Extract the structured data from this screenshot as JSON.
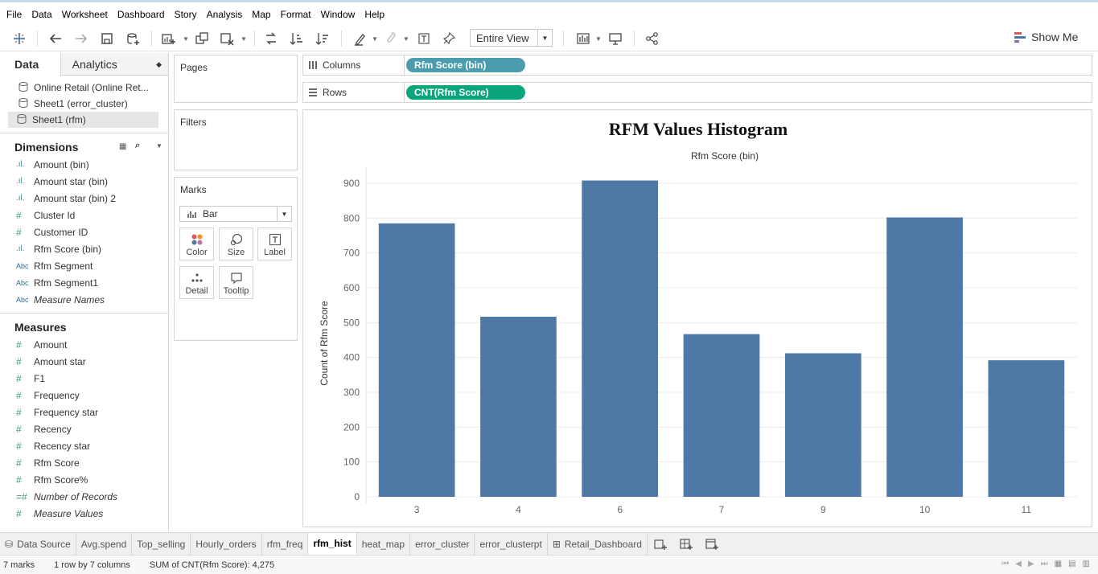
{
  "menu": [
    "File",
    "Data",
    "Worksheet",
    "Dashboard",
    "Story",
    "Analysis",
    "Map",
    "Format",
    "Window",
    "Help"
  ],
  "toolbar": {
    "fit": "Entire View",
    "show_me": "Show Me",
    "icons": [
      "tableau-logo-icon",
      "undo-icon",
      "redo-icon",
      "save-icon",
      "new-datasource-icon",
      "new-worksheet-icon",
      "duplicate-sheet-icon",
      "clear-sheet-icon",
      "swap-icon",
      "sort-ascending-icon",
      "sort-descending-icon",
      "highlight-icon",
      "group-icon",
      "label-icon",
      "pin-icon",
      "bar-chart-icon",
      "presentation-icon",
      "share-icon"
    ]
  },
  "data_pane": {
    "tabs": {
      "data": "Data",
      "analytics": "Analytics"
    },
    "datasources": [
      {
        "label": "Online Retail (Online Ret...",
        "selected": false
      },
      {
        "label": "Sheet1 (error_cluster)",
        "selected": false
      },
      {
        "label": "Sheet1 (rfm)",
        "selected": true
      }
    ],
    "dimensions_title": "Dimensions",
    "dimensions": [
      {
        "icon": "bin",
        "label": "Amount (bin)",
        "italic": false
      },
      {
        "icon": "bin",
        "label": "Amount star (bin)",
        "italic": false
      },
      {
        "icon": "bin",
        "label": "Amount star (bin) 2",
        "italic": false
      },
      {
        "icon": "hash",
        "label": "Cluster Id",
        "italic": false
      },
      {
        "icon": "hash",
        "label": "Customer ID",
        "italic": false
      },
      {
        "icon": "bin",
        "label": "Rfm Score (bin)",
        "italic": false
      },
      {
        "icon": "abc",
        "label": "Rfm Segment",
        "italic": false
      },
      {
        "icon": "abc",
        "label": "Rfm Segment1",
        "italic": false
      },
      {
        "icon": "abc",
        "label": "Measure Names",
        "italic": true
      }
    ],
    "measures_title": "Measures",
    "measures": [
      {
        "icon": "hash",
        "label": "Amount",
        "italic": false
      },
      {
        "icon": "hash",
        "label": "Amount star",
        "italic": false
      },
      {
        "icon": "hash",
        "label": "F1",
        "italic": false
      },
      {
        "icon": "hash",
        "label": "Frequency",
        "italic": false
      },
      {
        "icon": "hash",
        "label": "Frequency star",
        "italic": false
      },
      {
        "icon": "hash",
        "label": "Recency",
        "italic": false
      },
      {
        "icon": "hash",
        "label": "Recency star",
        "italic": false
      },
      {
        "icon": "hash",
        "label": "Rfm Score",
        "italic": false
      },
      {
        "icon": "hash",
        "label": "Rfm Score%",
        "italic": false
      },
      {
        "icon": "calc",
        "label": "Number of Records",
        "italic": true
      },
      {
        "icon": "hash",
        "label": "Measure Values",
        "italic": true
      }
    ]
  },
  "cards": {
    "pages": "Pages",
    "filters": "Filters",
    "marks": "Marks",
    "mark_type": "Bar",
    "mark_buttons": [
      "Color",
      "Size",
      "Label",
      "Detail",
      "Tooltip"
    ]
  },
  "shelves": {
    "columns_label": "Columns",
    "columns_pill": "Rfm Score (bin)",
    "rows_label": "Rows",
    "rows_pill": "CNT(Rfm Score)"
  },
  "colors": {
    "bar": "#4e79a7",
    "columns_pill": "#4b9dae",
    "rows_pill": "#0aa67b"
  },
  "chart_data": {
    "type": "bar",
    "title": "RFM Values Histogram",
    "xlabel": "Rfm Score (bin)",
    "ylabel": "Count of Rfm Score",
    "categories": [
      "3",
      "4",
      "6",
      "7",
      "9",
      "10",
      "11"
    ],
    "values": [
      785,
      517,
      908,
      467,
      412,
      802,
      392
    ],
    "ylim": [
      0,
      900
    ],
    "yticks": [
      0,
      100,
      200,
      300,
      400,
      500,
      600,
      700,
      800,
      900
    ],
    "grid": true
  },
  "sheet_tabs": {
    "data_source": "Data Source",
    "sheets": [
      {
        "label": "Avg.spend",
        "active": false,
        "icon": ""
      },
      {
        "label": "Top_selling",
        "active": false,
        "icon": ""
      },
      {
        "label": "Hourly_orders",
        "active": false,
        "icon": ""
      },
      {
        "label": "rfm_freq",
        "active": false,
        "icon": ""
      },
      {
        "label": "rfm_hist",
        "active": true,
        "icon": ""
      },
      {
        "label": "heat_map",
        "active": false,
        "icon": ""
      },
      {
        "label": "error_cluster",
        "active": false,
        "icon": ""
      },
      {
        "label": "error_clusterpt",
        "active": false,
        "icon": ""
      },
      {
        "label": "Retail_Dashboard",
        "active": false,
        "icon": "dashboard"
      }
    ]
  },
  "status": {
    "marks": "7 marks",
    "layout": "1 row by 7 columns",
    "sum": "SUM of CNT(Rfm Score): 4,275"
  }
}
